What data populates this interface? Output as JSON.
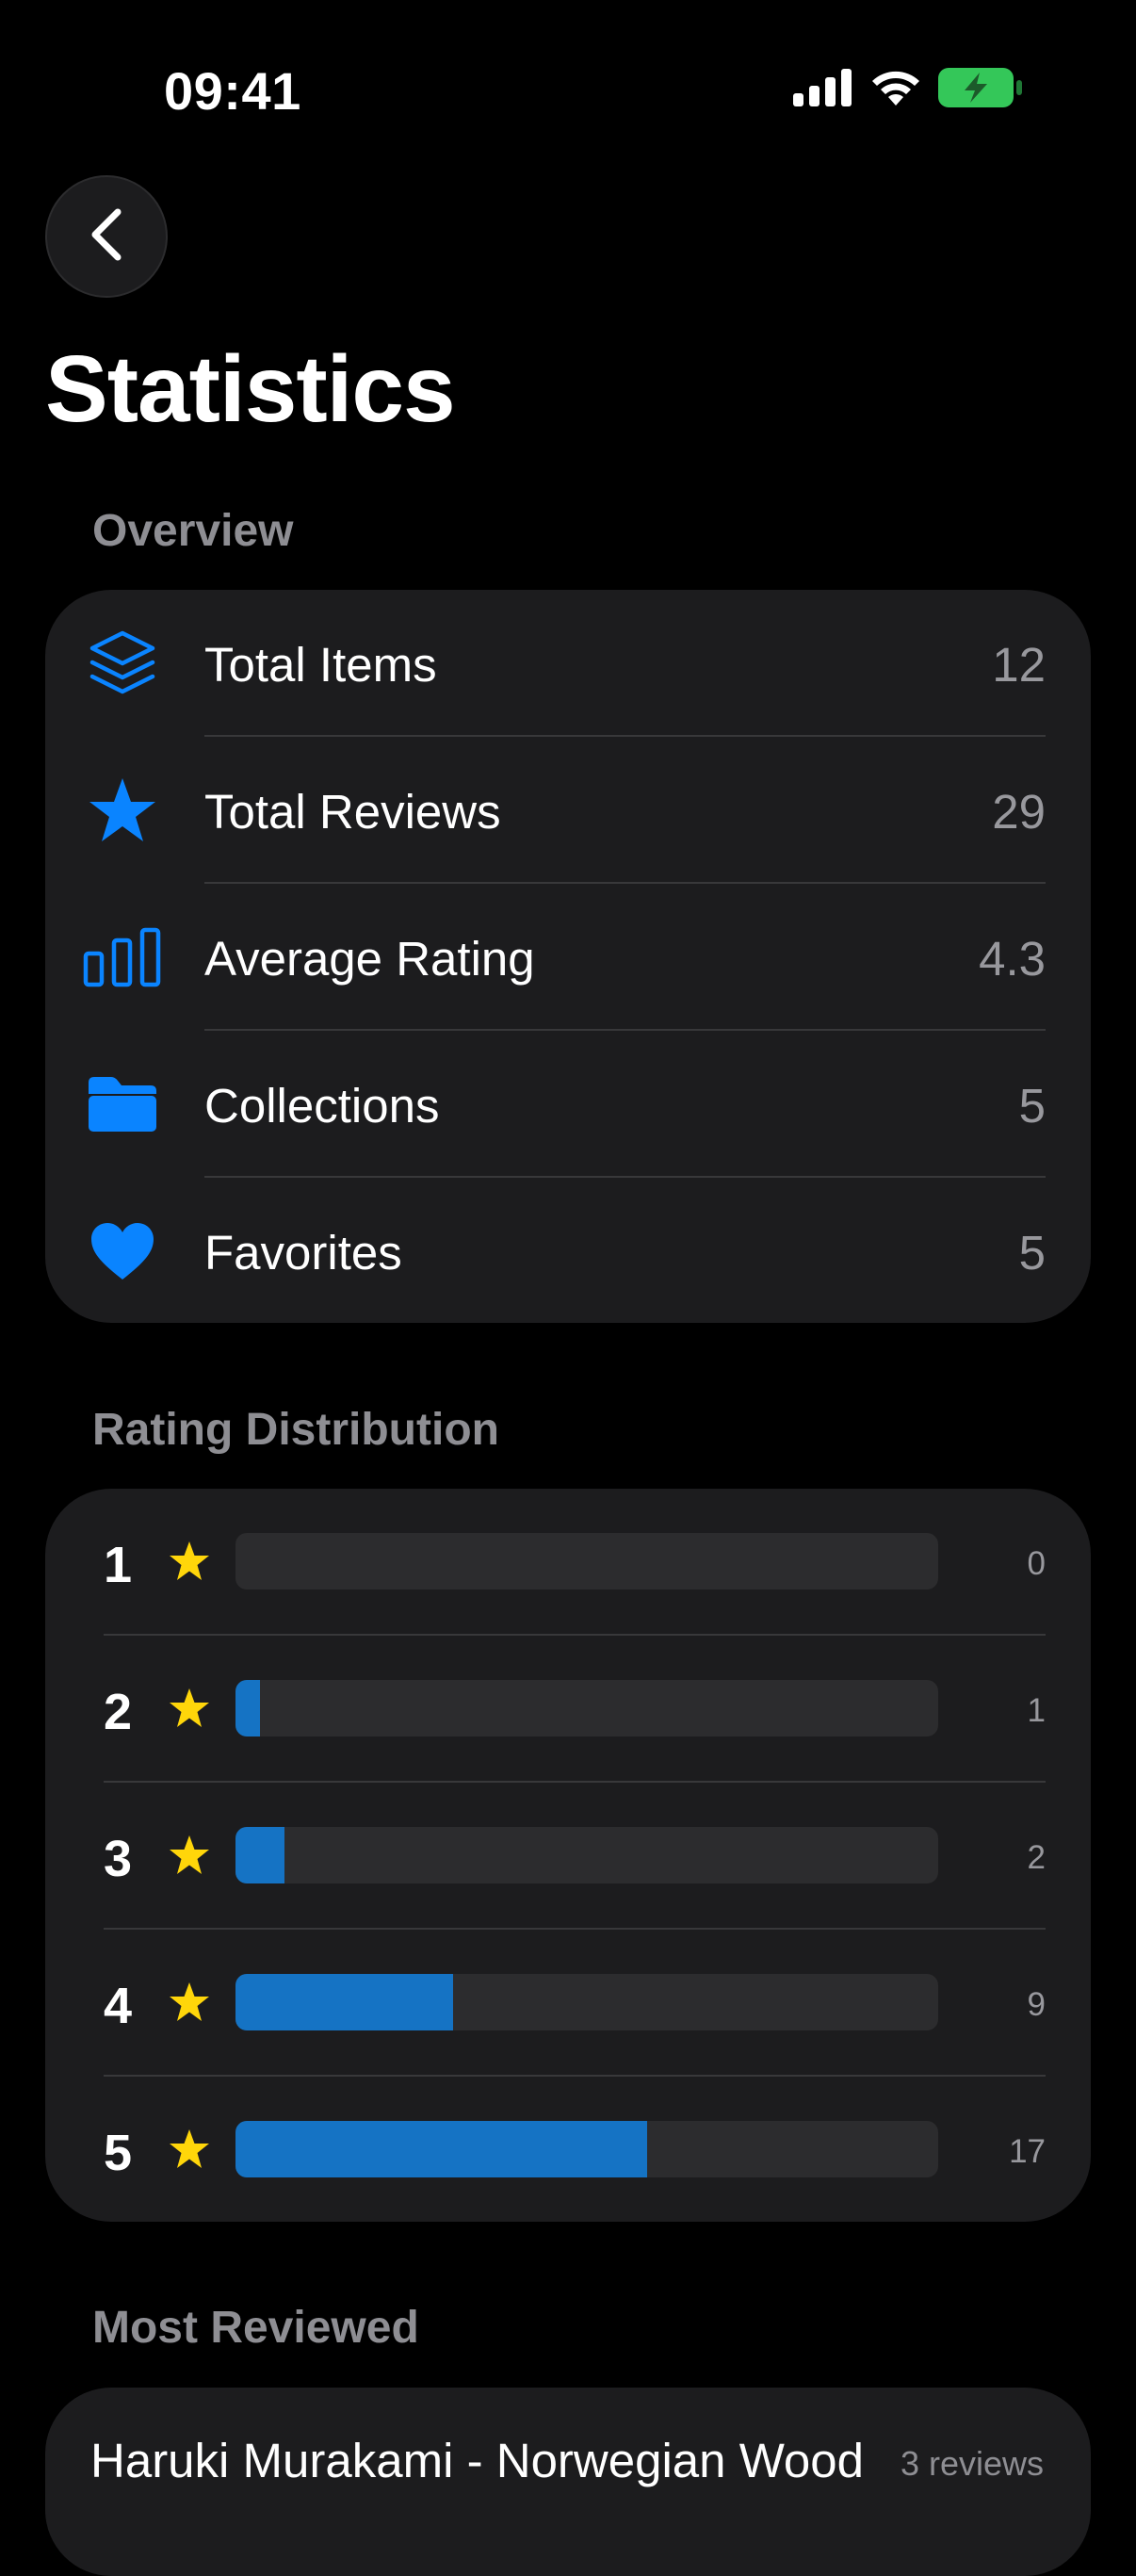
{
  "status_bar": {
    "time": "09:41",
    "battery_color": "#34c759"
  },
  "nav": {
    "back_icon": "chevron-left-icon"
  },
  "page": {
    "title": "Statistics"
  },
  "overview": {
    "header": "Overview",
    "items": [
      {
        "icon": "stack-layers-icon",
        "label": "Total Items",
        "value": "12"
      },
      {
        "icon": "star-icon",
        "label": "Total Reviews",
        "value": "29"
      },
      {
        "icon": "bar-chart-icon",
        "label": "Average Rating",
        "value": "4.3"
      },
      {
        "icon": "folder-icon",
        "label": "Collections",
        "value": "5"
      },
      {
        "icon": "heart-icon",
        "label": "Favorites",
        "value": "5"
      }
    ],
    "accent_color": "#0a84ff"
  },
  "rating_distribution": {
    "header": "Rating Distribution",
    "rows": [
      {
        "stars": "1",
        "count": "0",
        "fraction": 0.0
      },
      {
        "stars": "2",
        "count": "1",
        "fraction": 0.035
      },
      {
        "stars": "3",
        "count": "2",
        "fraction": 0.07
      },
      {
        "stars": "4",
        "count": "9",
        "fraction": 0.31
      },
      {
        "stars": "5",
        "count": "17",
        "fraction": 0.586
      }
    ],
    "bar_color": "#1573c4",
    "star_color": "#ffd60a"
  },
  "most_reviewed": {
    "header": "Most Reviewed",
    "items": [
      {
        "title": "Haruki Murakami - Norwegian Wood",
        "count": "3 reviews"
      }
    ]
  }
}
